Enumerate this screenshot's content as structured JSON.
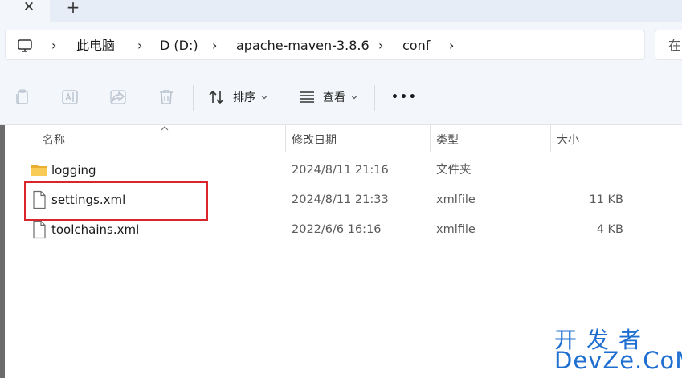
{
  "tabs": {
    "close_glyph": "✕",
    "new_glyph": "+"
  },
  "address": {
    "crumbs": [
      "此电脑",
      "D (D:)",
      "apache-maven-3.8.6",
      "conf"
    ],
    "separator": "›",
    "search_placeholder": "在"
  },
  "toolbar": {
    "sort_label": "排序",
    "view_label": "查看",
    "more_glyph": "•••",
    "icons": [
      "copy-icon",
      "rename-icon",
      "share-icon",
      "delete-icon",
      "sort-icon",
      "view-icon",
      "more-icon"
    ]
  },
  "columns": {
    "name": "名称",
    "date": "修改日期",
    "type": "类型",
    "size": "大小"
  },
  "files": [
    {
      "name": "logging",
      "date": "2024/8/11 21:16",
      "type": "文件夹",
      "size": "",
      "icon": "folder-icon"
    },
    {
      "name": "settings.xml",
      "date": "2024/8/11 21:33",
      "type": "xmlfile",
      "size": "11 KB",
      "icon": "file-icon"
    },
    {
      "name": "toolchains.xml",
      "date": "2022/6/6 16:16",
      "type": "xmlfile",
      "size": "4 KB",
      "icon": "file-icon"
    }
  ],
  "watermark": {
    "line1": "开发者",
    "line2": "DevZe.CoM"
  },
  "colors": {
    "accent_folder": "#f2c14e",
    "highlight": "#d9262c",
    "watermark": "#1f6fd1"
  }
}
